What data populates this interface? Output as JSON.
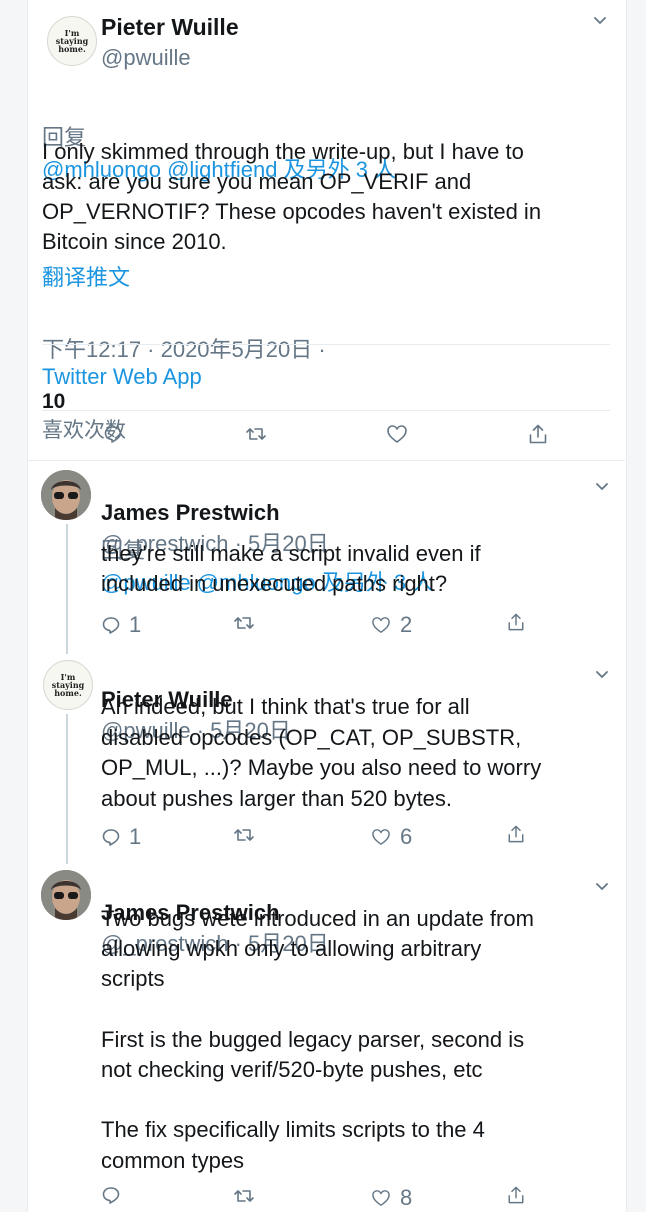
{
  "main_tweet": {
    "name": "Pieter Wuille",
    "handle": "@pwuille",
    "avatar_text": [
      "I'm",
      "staying",
      "home."
    ],
    "reply_prefix": "回复",
    "reply_to": "@mhluongo @lightfiend 及另外 3 人",
    "body": "I only skimmed through the write-up, but I have to\nask: are you sure you mean OP_VERIF and\nOP_VERNOTIF? These opcodes haven't existed in\nBitcoin since 2010.",
    "translate": "翻译推文",
    "time": "下午12:17 · 2020年5月20日 ·",
    "source": "Twitter Web App",
    "likes_count": "10",
    "likes_label": "喜欢次数"
  },
  "replies": [
    {
      "name": "James Prestwich",
      "meta": "@_prestwich · 5月20日",
      "reply_prefix": "回复",
      "reply_to": "@pwuille @mhluongo 及另外 3 人",
      "body": "they're still make a script invalid even if\nincluded in unexecuted paths right?",
      "replies": "1",
      "retweets": "",
      "likes": "2"
    },
    {
      "name": "Pieter Wuille",
      "meta": "@pwuille · 5月20日",
      "body": "Ah indeed, but I think that's true for all\ndisabled opcodes (OP_CAT, OP_SUBSTR,\nOP_MUL, ...)? Maybe you also need to worry\nabout pushes larger than 520 bytes.",
      "replies": "1",
      "retweets": "",
      "likes": "6"
    },
    {
      "name": "James Prestwich",
      "meta": "@_prestwich · 5月20日",
      "body": "Two bugs wete introduced in an update from\nallowing wpkh only to allowing arbitrary\nscripts\n\nFirst is the bugged legacy parser, second is\nnot checking verif/520-byte pushes, etc\n\nThe fix specifically limits scripts to the 4\ncommon types",
      "replies": "",
      "retweets": "",
      "likes": "8"
    }
  ],
  "colors": {
    "link": "#1b95e0",
    "secondary": "#657786",
    "text": "#14171a",
    "border": "#e6ecf0"
  },
  "icons": [
    "chevron-down-icon",
    "reply-icon",
    "retweet-icon",
    "like-icon",
    "share-icon"
  ]
}
